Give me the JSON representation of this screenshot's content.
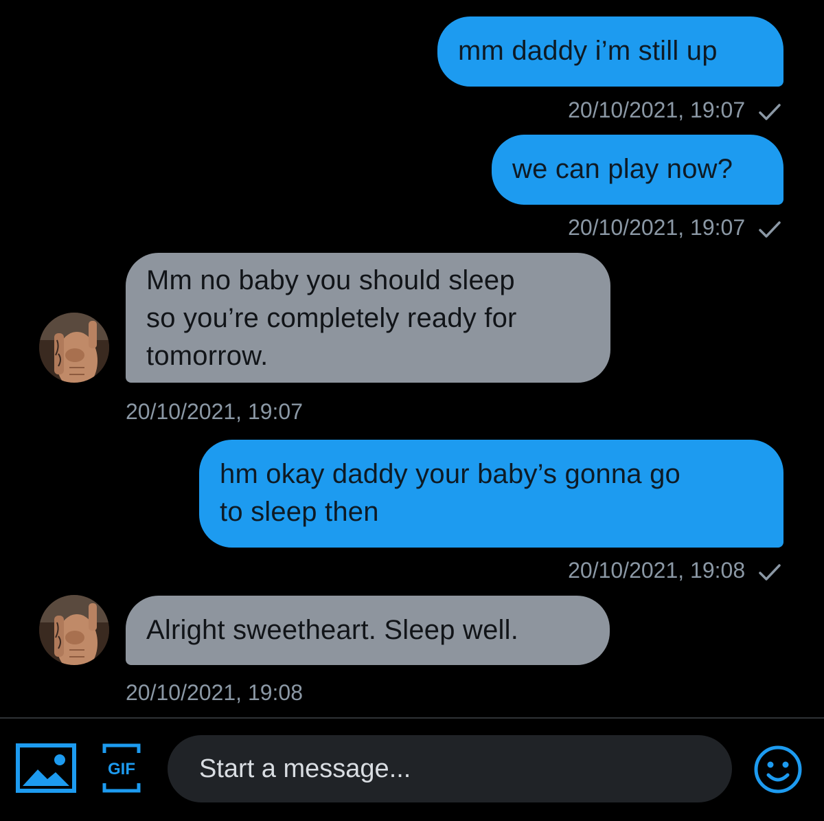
{
  "messages": [
    {
      "direction": "sent",
      "text": "mm daddy i’m still up",
      "timestamp": "20/10/2021, 19:07",
      "read_receipt": "check-icon"
    },
    {
      "direction": "sent",
      "text": "we can play now?",
      "timestamp": "20/10/2021, 19:07",
      "read_receipt": "check-icon"
    },
    {
      "direction": "received",
      "lines": [
        "Mm no baby you should sleep",
        "so you’re completely ready for",
        "tomorrow."
      ],
      "timestamp": "20/10/2021, 19:07"
    },
    {
      "direction": "sent",
      "lines": [
        "hm okay daddy your baby’s gonna go",
        "to sleep then"
      ],
      "timestamp": "20/10/2021, 19:08",
      "read_receipt": "check-icon"
    },
    {
      "direction": "received",
      "text": "Alright sweetheart. Sleep well.",
      "timestamp": "20/10/2021, 19:08"
    }
  ],
  "composer": {
    "placeholder": "Start a message...",
    "gif_label": "GIF",
    "media_icon": "image-icon",
    "gif_icon": "gif-icon",
    "emoji_icon": "emoji-icon"
  },
  "colors": {
    "background": "#000000",
    "sent_bubble": "#1d9bf0",
    "received_bubble": "#8e959e",
    "timestamp": "#8b98a5",
    "accent": "#1d9bf0",
    "composer_field": "#202327"
  }
}
